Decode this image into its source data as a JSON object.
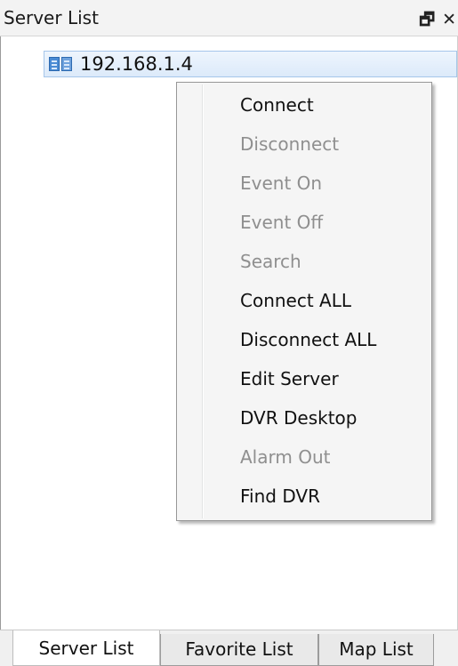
{
  "titlebar": {
    "title": "Server List",
    "float_glyph": "🗗",
    "close_glyph": "✕"
  },
  "tree": {
    "items": [
      {
        "label": "192.168.1.4",
        "icon": "server-icon"
      }
    ]
  },
  "context_menu": {
    "items": [
      {
        "label": "Connect",
        "enabled": true
      },
      {
        "label": "Disconnect",
        "enabled": false
      },
      {
        "label": "Event On",
        "enabled": false
      },
      {
        "label": "Event Off",
        "enabled": false
      },
      {
        "label": "Search",
        "enabled": false
      },
      {
        "label": "Connect ALL",
        "enabled": true
      },
      {
        "label": "Disconnect ALL",
        "enabled": true
      },
      {
        "label": "Edit Server",
        "enabled": true
      },
      {
        "label": "DVR Desktop",
        "enabled": true
      },
      {
        "label": "Alarm Out",
        "enabled": false
      },
      {
        "label": "Find DVR",
        "enabled": true
      }
    ]
  },
  "tabs": [
    {
      "label": "Server List",
      "active": true
    },
    {
      "label": "Favorite List",
      "active": false
    },
    {
      "label": "Map List",
      "active": false
    }
  ],
  "colors": {
    "selection": "#dceafa",
    "disabled_text": "#8f8f8f",
    "menu_background": "#f5f5f5"
  }
}
